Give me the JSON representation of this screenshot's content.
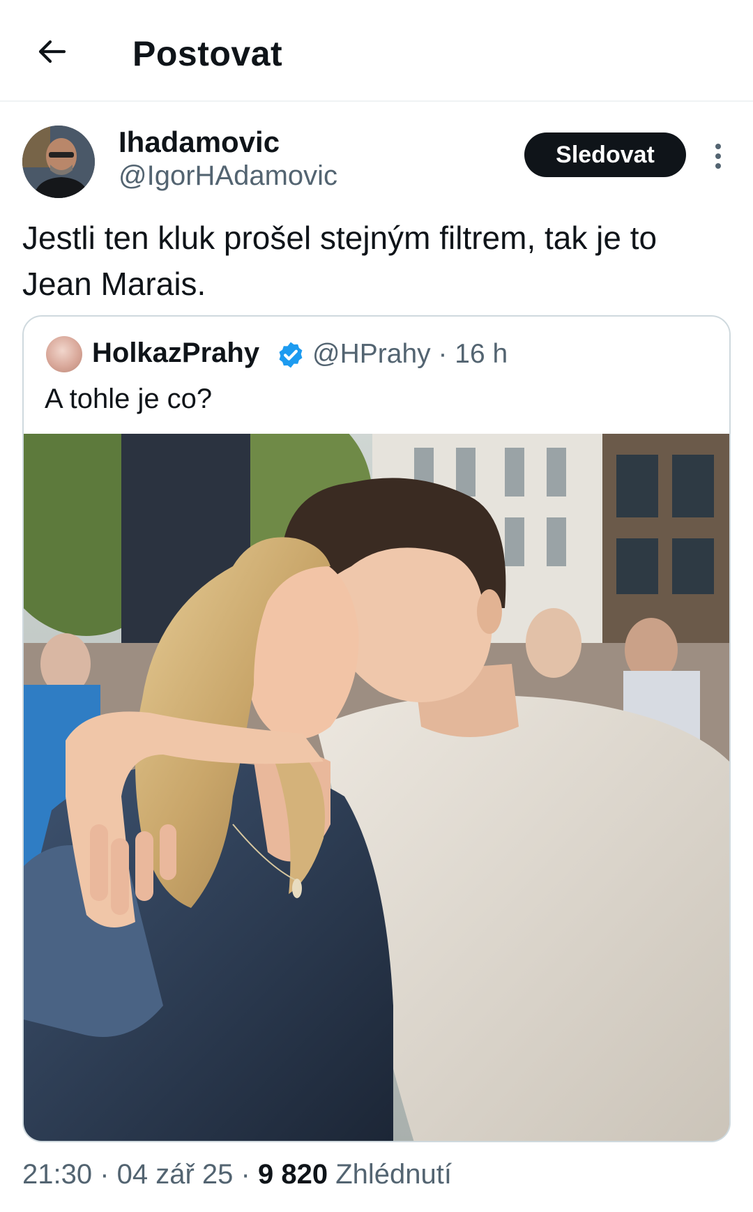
{
  "header": {
    "title": "Postovat",
    "back_icon": "arrow-left-icon"
  },
  "post": {
    "author": {
      "display_name": "Ihadamovic",
      "handle": "@IgorHAdamovic",
      "avatar": "avatar-photo"
    },
    "follow_label": "Sledovat",
    "more_icon": "more-vertical-icon",
    "text": "Jestli ten kluk prošel stejným filtrem, tak je to Jean Marais."
  },
  "quote": {
    "display_name": "HolkazPrahy",
    "verified_icon": "verified-badge-icon",
    "verified_color": "#1d9bf0",
    "meta": "@HPrahy · 16 h",
    "text": "A tohle je co?",
    "image": "photo-woman-and-young-man"
  },
  "footer": {
    "timestamp": "21:30 · 04 zář 25 · ",
    "views_count": "9 820",
    "views_label": " Zhlédnutí"
  },
  "colors": {
    "text_primary": "#0f1419",
    "text_secondary": "#536471",
    "border": "#cfd9de",
    "button_bg": "#0f1419"
  }
}
